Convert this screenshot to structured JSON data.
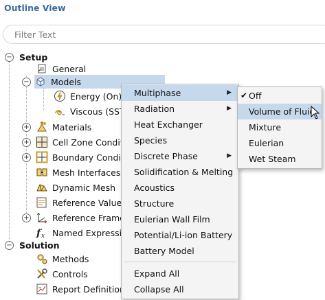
{
  "panel_title": "Outline View",
  "filter": {
    "placeholder": "Filter Text",
    "value": ""
  },
  "tree": {
    "setup": "Setup",
    "general": "General",
    "models": "Models",
    "energy": "Energy (On)",
    "viscous": "Viscous (SST",
    "materials": "Materials",
    "cell_zone": "Cell Zone Condit",
    "boundary": "Boundary Condit",
    "mesh_interfaces": "Mesh Interfaces",
    "dynamic_mesh": "Dynamic Mesh",
    "reference_values": "Reference Value",
    "reference_frames": "Reference Frame",
    "named_expressions": "Named Expressi",
    "solution": "Solution",
    "methods": "Methods",
    "controls": "Controls",
    "report_definitions": "Report Definition"
  },
  "menu": {
    "items": [
      "Multiphase",
      "Radiation",
      "Heat Exchanger",
      "Species",
      "Discrete Phase",
      "Solidification & Melting",
      "Acoustics",
      "Structure",
      "Eulerian Wall Film",
      "Potential/Li-ion Battery",
      "Battery Model"
    ],
    "expand_all": "Expand All",
    "collapse_all": "Collapse All"
  },
  "submenu": {
    "items": [
      "Off",
      "Volume of Fluid",
      "Mixture",
      "Eulerian",
      "Wet Steam"
    ],
    "checked": "Off",
    "hovered": "Volume of Fluid"
  },
  "colors": {
    "accent": "#3a6c9e",
    "highlight": "#c6d8ec"
  }
}
